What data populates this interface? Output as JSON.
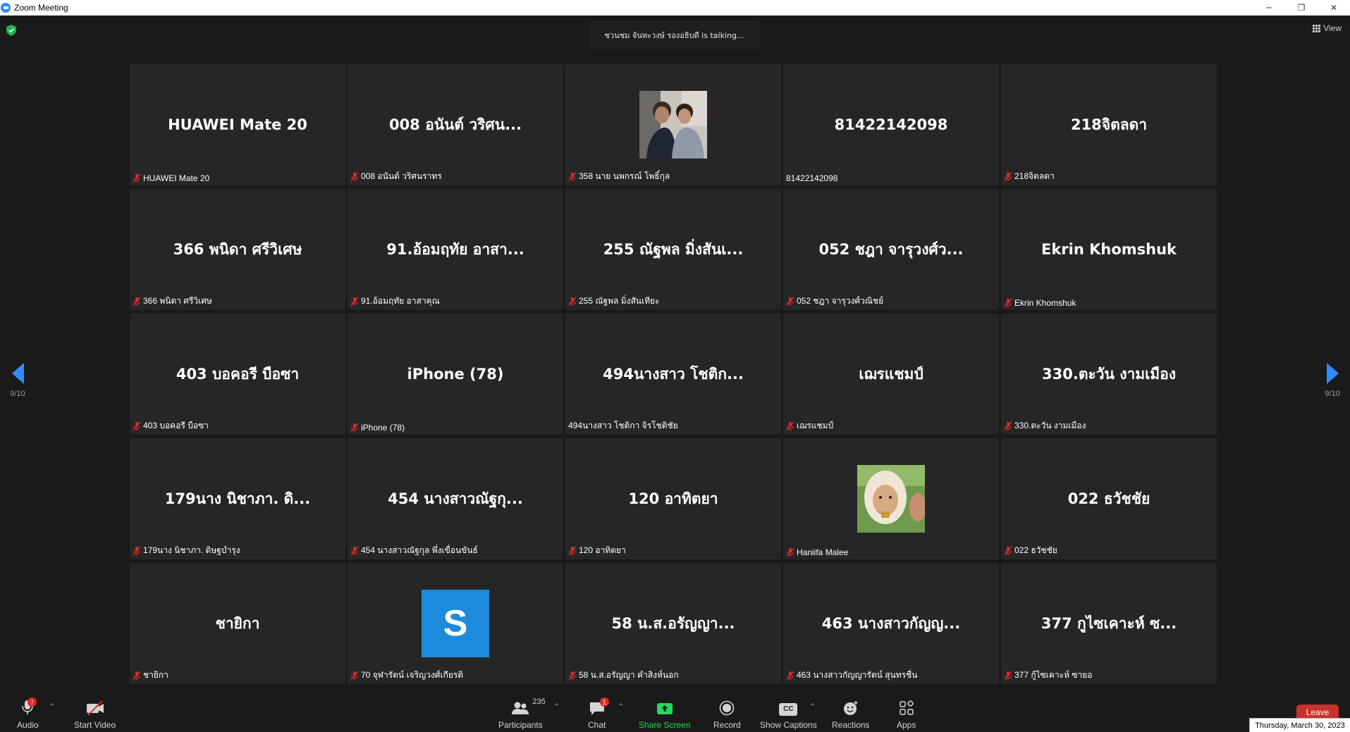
{
  "window": {
    "title": "Zoom Meeting",
    "minimize": "─",
    "restore": "❐",
    "close": "✕"
  },
  "talking": "ชวนชม จันทะวงษ์ รองอธิบดี is  talking...",
  "view_label": "View",
  "page": {
    "left": "9/10",
    "right": "9/10"
  },
  "tiles": [
    {
      "display": "HUAWEI Mate 20",
      "name": "HUAWEI Mate 20",
      "muted": true
    },
    {
      "display": "008 อนันต์ วริศน...",
      "name": "008 อนันต์ วริศนราทร",
      "muted": true
    },
    {
      "display": "",
      "name": "358 นาย นพกรณ์ โพธิ์กุล",
      "muted": true,
      "media": "photo-two-men"
    },
    {
      "display": "81422142098",
      "name": "81422142098",
      "muted": false
    },
    {
      "display": "218จิตลดา",
      "name": "218จิตลดา",
      "muted": true
    },
    {
      "display": "366 พนิดา ศรีวิเศษ",
      "name": "366 พนิดา ศรีวิเศษ",
      "muted": true
    },
    {
      "display": "91.อ้อมฤทัย อาสา...",
      "name": "91.อ้อมฤทัย อาสาคุณ",
      "muted": true
    },
    {
      "display": "255 ณัฐพล มิ่งสันเ...",
      "name": "255 ณัฐพล มิ่งสันเทียะ",
      "muted": true
    },
    {
      "display": "052 ชฎา จารุวงศ์ว...",
      "name": "052 ชฎา จารุวงศ์วณิชย์",
      "muted": true
    },
    {
      "display": "Ekrin Khomshuk",
      "name": "Ekrin Khomshuk",
      "muted": true
    },
    {
      "display": "403 บอคอรี  บือซา",
      "name": "403 บอคอรี  บือซา",
      "muted": true
    },
    {
      "display": "iPhone (78)",
      "name": "iPhone (78)",
      "muted": true
    },
    {
      "display": "494นางสาว โชติก...",
      "name": "494นางสาว โชติกา จิรโชติชัย",
      "muted": false
    },
    {
      "display": "เฌรแชมป์",
      "name": "เฌรแชมป์",
      "muted": true
    },
    {
      "display": "330.ตะวัน งามเมือง",
      "name": "330.ตะวัน งามเมือง",
      "muted": true
    },
    {
      "display": "179นาง นิชาภา. ดิ...",
      "name": "179นาง นิชาภา. ดิษฐบำรุง",
      "muted": true
    },
    {
      "display": "454 นางสาวณัฐกุ...",
      "name": "454 นางสาวณัฐกุล พึ่งเขื่อนขันธ์",
      "muted": true
    },
    {
      "display": "120 อาทิตยา",
      "name": "120 อาทิตยา",
      "muted": true
    },
    {
      "display": "",
      "name": "Haniifa Malee",
      "muted": true,
      "media": "photo-woman"
    },
    {
      "display": "022 ธวัชชัย",
      "name": "022 ธวัชชัย",
      "muted": true
    },
    {
      "display": "ชายิกา",
      "name": "ชายิกา",
      "muted": true
    },
    {
      "display": "",
      "name": "70 จุฬารัตน์ เจริญวงศ์เกียรติ",
      "muted": true,
      "media": "avatar",
      "avatar_letter": "S"
    },
    {
      "display": "58 น.ส.อรัญญา...",
      "name": "58 น.ส.อรัญญา คำสิงห์นอก",
      "muted": true
    },
    {
      "display": "463 นางสาวกัญญ...",
      "name": "463 นางสาวกัญญารัตน์ สุนทรชื่น",
      "muted": true
    },
    {
      "display": "377 กูไซเคาะห์ ซ...",
      "name": "377 กู้ไซเคาะห์ ซายอ",
      "muted": true
    }
  ],
  "toolbar": {
    "audio": {
      "label": "Audio",
      "badge": "!"
    },
    "video": {
      "label": "Start Video"
    },
    "participants": {
      "label": "Participants",
      "count": "235"
    },
    "chat": {
      "label": "Chat",
      "badge": "1"
    },
    "share": {
      "label": "Share Screen"
    },
    "record": {
      "label": "Record"
    },
    "captions": {
      "label": "Show Captions",
      "icon_text": "CC"
    },
    "reactions": {
      "label": "Reactions"
    },
    "apps": {
      "label": "Apps"
    },
    "leave": {
      "label": "Leave"
    },
    "caret": "^"
  },
  "datetime": "Thursday, March 30, 2023",
  "colors": {
    "accent": "#2d8cff",
    "share_green": "#23d959",
    "leave_red": "#c8322c",
    "tile_bg": "#262626",
    "mute_red": "#e02828"
  }
}
